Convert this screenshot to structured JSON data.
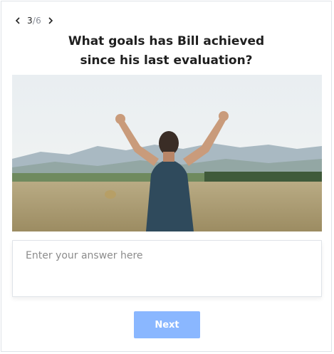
{
  "pager": {
    "current": "3",
    "separator": "/",
    "total": "6"
  },
  "question": {
    "line1": "What goals has Bill achieved",
    "line2": "since his last evaluation?"
  },
  "icons": {
    "prev": "chevron-left-icon",
    "next": "chevron-right-icon"
  },
  "answer": {
    "placeholder": "Enter your answer here",
    "value": ""
  },
  "next_button": {
    "label": "Next"
  },
  "colors": {
    "accent": "#8ab7ff",
    "text": "#1f1f1f",
    "border": "#dfe3e8"
  }
}
